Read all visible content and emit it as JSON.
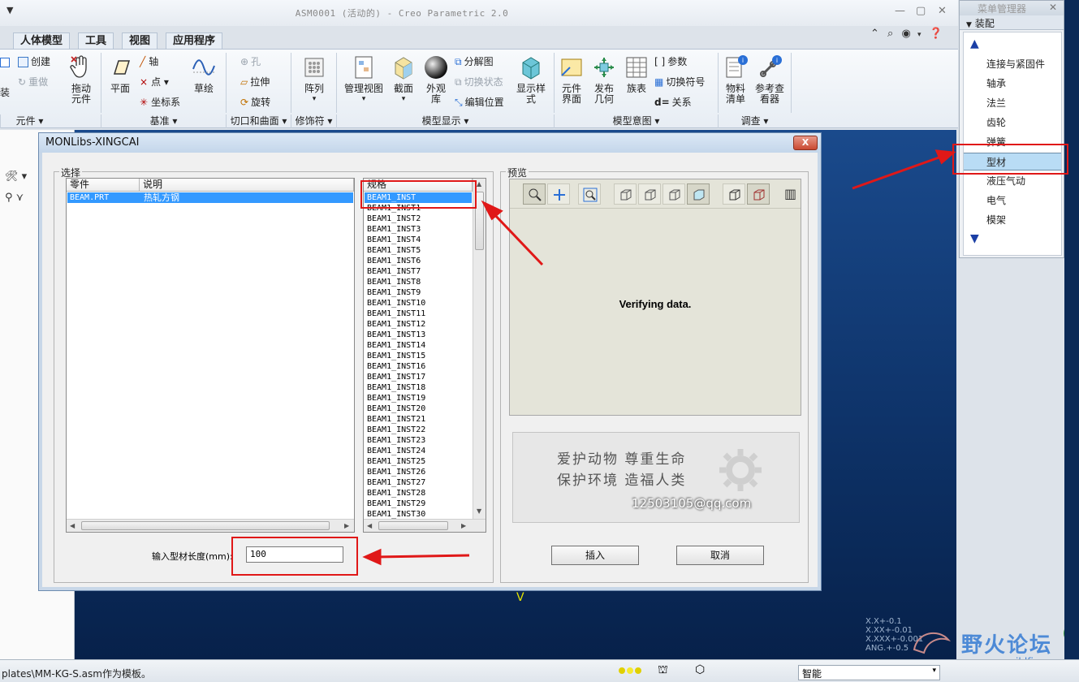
{
  "window": {
    "title": "ASM0001 (活动的) - Creo Parametric 2.0",
    "quick_access": "▼"
  },
  "ribbon": {
    "tabs": [
      "人体模型",
      "工具",
      "视图",
      "应用程序"
    ],
    "buttons": {
      "create": "创建",
      "redo": "重做",
      "install": "装",
      "drag_line1": "拖动",
      "drag_line2": "元件",
      "plane": "平面",
      "axis": "轴",
      "point": "点",
      "csys": "坐标系",
      "sketch": "草绘",
      "hole": "孔",
      "extrude": "拉伸",
      "revolve": "旋转",
      "pattern": "阵列",
      "manage_view": "管理视图",
      "section": "截面",
      "appearance_line1": "外观",
      "appearance_line2": "库",
      "explode": "分解图",
      "toggle_state": "切换状态",
      "edit_position": "编辑位置",
      "display_style_line1": "显示样",
      "display_style_line2": "式",
      "comp_iface_line1": "元件",
      "comp_iface_line2": "界面",
      "publish_geom_line1": "发布",
      "publish_geom_line2": "几何",
      "family_table": "族表",
      "params": "参数",
      "switch_symbol": "切换符号",
      "relations": "关系",
      "bom_line1": "物料",
      "bom_line2": "清单",
      "ref_viewer_line1": "参考查",
      "ref_viewer_line2": "看器"
    },
    "groups": [
      "元件 ▾",
      "基准 ▾",
      "切口和曲面 ▾",
      "修饰符 ▾",
      "模型显示 ▾",
      "模型意图 ▾",
      "调查 ▾"
    ]
  },
  "menu_manager": {
    "title": "菜单管理器",
    "section": "装配",
    "items": [
      "连接与紧固件",
      "轴承",
      "法兰",
      "齿轮",
      "弹簧",
      "型材",
      "液压气动",
      "电气",
      "模架"
    ],
    "selected": "型材"
  },
  "dialog": {
    "title": "MONLibs-XINGCAI",
    "close_label": "X",
    "select_group": "选择",
    "preview_group": "预览",
    "parts_table": {
      "columns": [
        "零件",
        "说明"
      ],
      "rows": [
        {
          "part": "BEAM.PRT",
          "desc": "热轧方钢"
        }
      ]
    },
    "spec_column": "规格",
    "spec_items": [
      "BEAM1_INST",
      "BEAM1_INST1",
      "BEAM1_INST2",
      "BEAM1_INST3",
      "BEAM1_INST4",
      "BEAM1_INST5",
      "BEAM1_INST6",
      "BEAM1_INST7",
      "BEAM1_INST8",
      "BEAM1_INST9",
      "BEAM1_INST10",
      "BEAM1_INST11",
      "BEAM1_INST12",
      "BEAM1_INST13",
      "BEAM1_INST14",
      "BEAM1_INST15",
      "BEAM1_INST16",
      "BEAM1_INST17",
      "BEAM1_INST18",
      "BEAM1_INST19",
      "BEAM1_INST20",
      "BEAM1_INST21",
      "BEAM1_INST22",
      "BEAM1_INST23",
      "BEAM1_INST24",
      "BEAM1_INST25",
      "BEAM1_INST26",
      "BEAM1_INST27",
      "BEAM1_INST28",
      "BEAM1_INST29",
      "BEAM1_INST30"
    ],
    "spec_selected": "BEAM1_INST",
    "preview_status": "Verifying data.",
    "banner_line1": "爱护动物  尊重生命",
    "banner_line2": "保护环境  造福人类",
    "banner_email": "12503105@qq.com",
    "length_label": "输入型材长度(mm):",
    "length_value": "100",
    "insert_label": "插入",
    "cancel_label": "取消"
  },
  "viewport": {
    "coords": [
      "X.X+-0.1",
      "X.XX+-0.01",
      "X.XXX+-0.001",
      "ANG.+-0.5"
    ]
  },
  "statusbar": {
    "message": "plates\\MM-KG-S.asm作为模板。",
    "filter_value": "智能"
  },
  "watermark": {
    "text": "野火论坛",
    "url": "www.proewildfire.cn",
    "badge": "39"
  },
  "colors": {
    "accent_red": "#e01818",
    "selection_blue": "#3399ff",
    "viewport_blue": "#0e3369"
  }
}
